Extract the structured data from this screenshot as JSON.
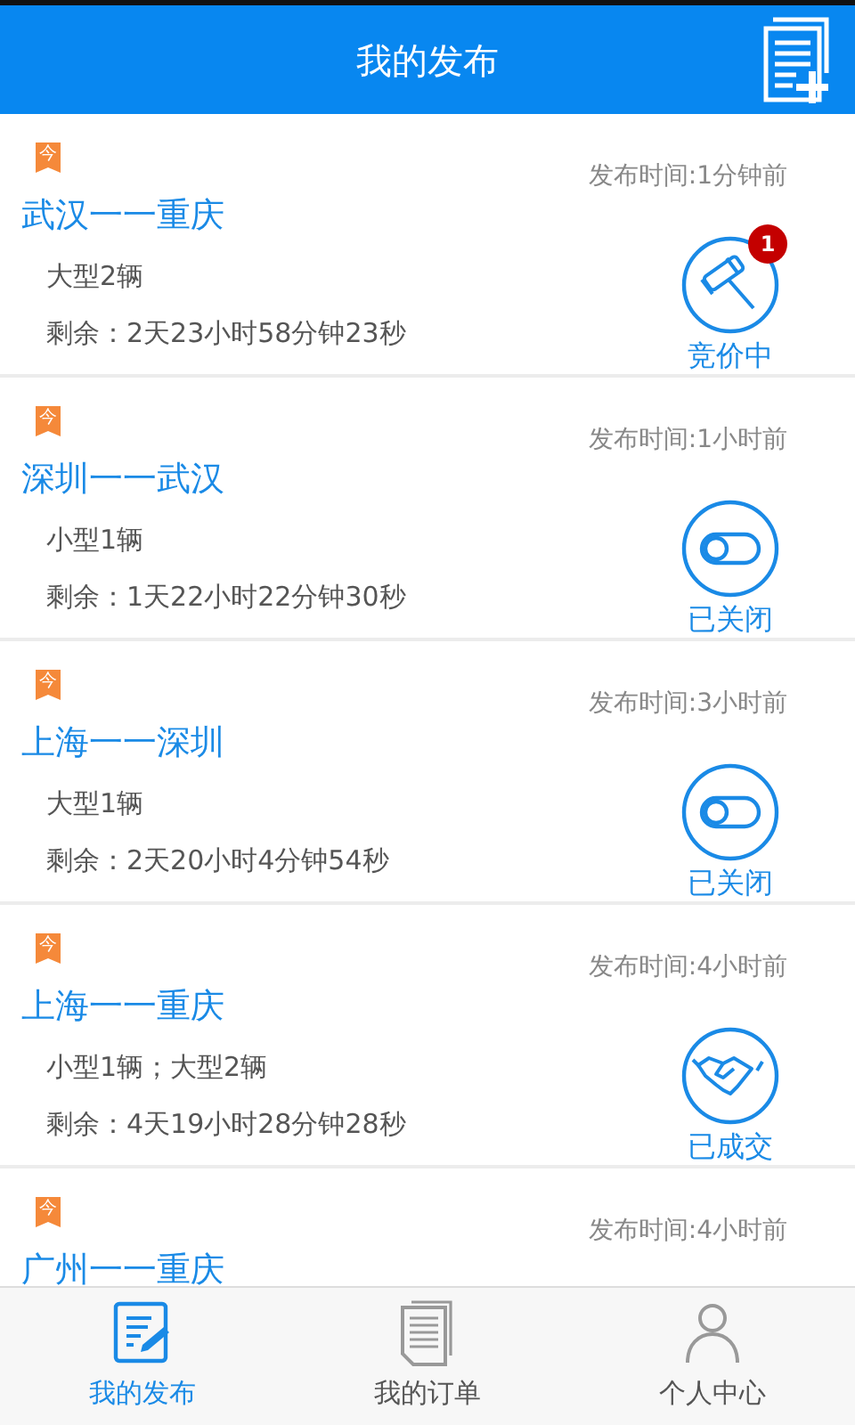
{
  "header": {
    "title": "我的发布"
  },
  "posts": [
    {
      "tag": "今",
      "time": "发布时间:1分钟前",
      "route": "武汉一一重庆",
      "vehicles": "大型2辆",
      "remaining": "剩余：2天23小时58分钟23秒",
      "status": {
        "kind": "bidding",
        "label": "竞价中",
        "badge": "1"
      }
    },
    {
      "tag": "今",
      "time": "发布时间:1小时前",
      "route": "深圳一一武汉",
      "vehicles": "小型1辆",
      "remaining": "剩余：1天22小时22分钟30秒",
      "status": {
        "kind": "closed",
        "label": "已关闭"
      }
    },
    {
      "tag": "今",
      "time": "发布时间:3小时前",
      "route": "上海一一深圳",
      "vehicles": "大型1辆",
      "remaining": "剩余：2天20小时4分钟54秒",
      "status": {
        "kind": "closed",
        "label": "已关闭"
      }
    },
    {
      "tag": "今",
      "time": "发布时间:4小时前",
      "route": "上海一一重庆",
      "vehicles": "小型1辆；大型2辆",
      "remaining": "剩余：4天19小时28分钟28秒",
      "status": {
        "kind": "deal",
        "label": "已成交"
      }
    },
    {
      "tag": "今",
      "time": "发布时间:4小时前",
      "route": "广州一一重庆"
    }
  ],
  "tabs": [
    {
      "kind": "publish",
      "label": "我的发布",
      "selected": true
    },
    {
      "kind": "orders",
      "label": "我的订单",
      "selected": false
    },
    {
      "kind": "profile",
      "label": "个人中心",
      "selected": false
    }
  ]
}
